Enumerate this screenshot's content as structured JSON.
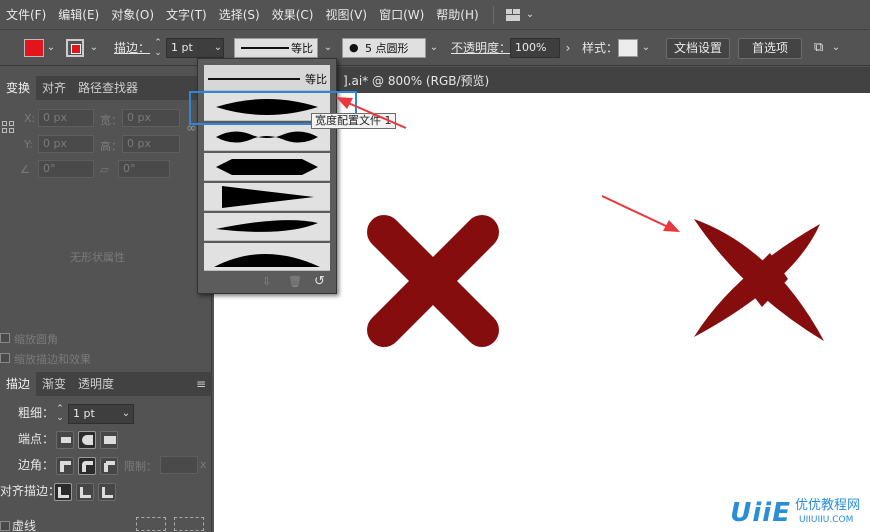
{
  "menu": {
    "items": [
      "文件(F)",
      "编辑(E)",
      "对象(O)",
      "文字(T)",
      "选择(S)",
      "效果(C)",
      "视图(V)",
      "窗口(W)",
      "帮助(H)"
    ],
    "workspace_icon": "layout-grid-icon"
  },
  "control_bar": {
    "fill_color": "#e3141d",
    "stroke_label": "描边：",
    "stroke_weight": "1 pt",
    "profile_label": "等比",
    "brush_label": "5 点圆形",
    "opacity_label": "不透明度：",
    "opacity_value": "100%",
    "style_label": "样式：",
    "doc_settings_button": "文档设置",
    "preferences_button": "首选项"
  },
  "transform_panel": {
    "tabs": [
      "变换",
      "对齐",
      "路径查找器"
    ],
    "x_label": "X:",
    "x_value": "0 px",
    "w_label": "宽：",
    "w_value": "0 px",
    "y_label": "Y:",
    "y_value": "0 px",
    "h_label": "高：",
    "h_value": "0 px",
    "angle_value": "0°",
    "shear_value": "0°",
    "no_shape_text": "无形状属性",
    "scale_corners": "缩放圆角",
    "scale_strokes": "缩放描边和效果"
  },
  "stroke_panel": {
    "tabs": [
      "描边",
      "渐变",
      "透明度"
    ],
    "weight_label": "粗细：",
    "weight_value": "1 pt",
    "cap_label": "端点：",
    "corner_label": "边角：",
    "limit_label": "限制：",
    "limit_suffix": "x",
    "align_label": "对齐描边：",
    "dashed_label": "虚线"
  },
  "document": {
    "tab_title": "].ai* @ 800% (RGB/预览)"
  },
  "profile_dropdown": {
    "first_label": "等比",
    "tooltip": "宽度配置文件 1"
  },
  "colors": {
    "x_shape": "#860d0d",
    "arrow": "#e8383d",
    "highlight": "#2f86d6",
    "watermark": "#2a8dd9"
  },
  "watermark": {
    "logo": "UiiE",
    "cn": "优优教程网",
    "url": "UIIUIIU.COM"
  }
}
